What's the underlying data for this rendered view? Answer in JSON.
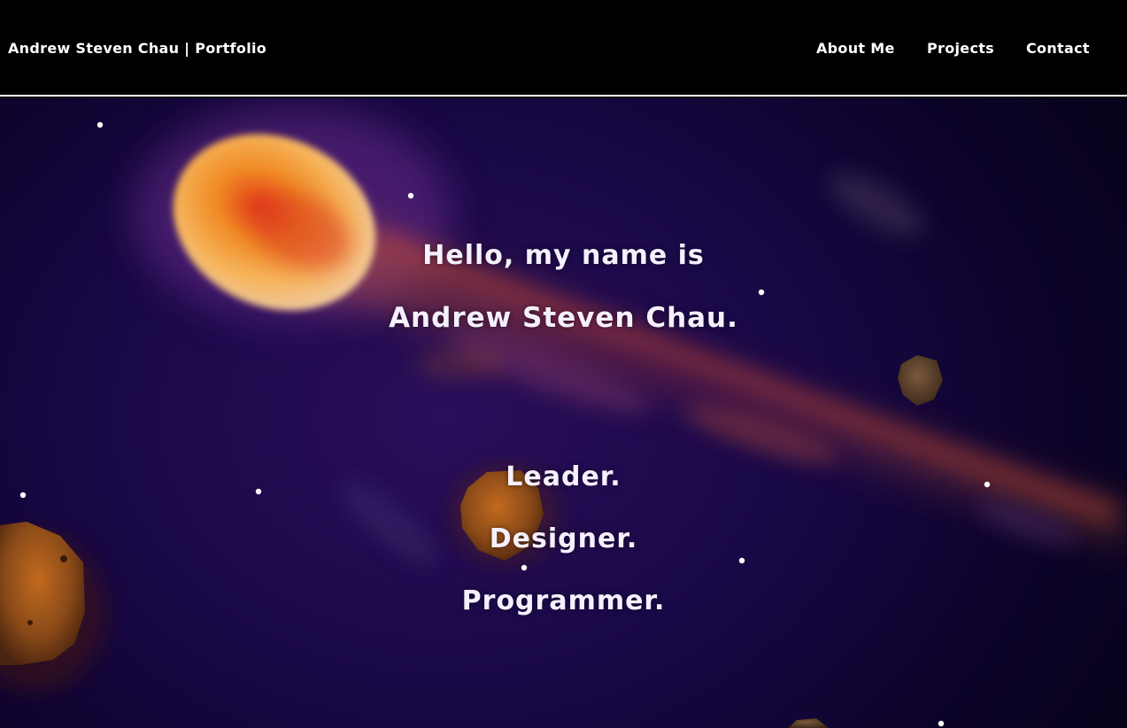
{
  "nav": {
    "brand": "Andrew Steven Chau | Portfolio",
    "links": [
      "About Me",
      "Projects",
      "Contact"
    ]
  },
  "hero": {
    "greeting": "Hello, my name is",
    "name": "Andrew Steven Chau.",
    "roles": [
      "Leader.",
      "Designer.",
      "Programmer."
    ]
  },
  "colors": {
    "nav_background": "#000000",
    "nav_border": "#ffffff",
    "space_background": "#180846",
    "comet_core": "#f08a24",
    "text": "#f5f0ff"
  },
  "icons": [
    "comet-illustration",
    "asteroid-icon",
    "star-icon"
  ]
}
